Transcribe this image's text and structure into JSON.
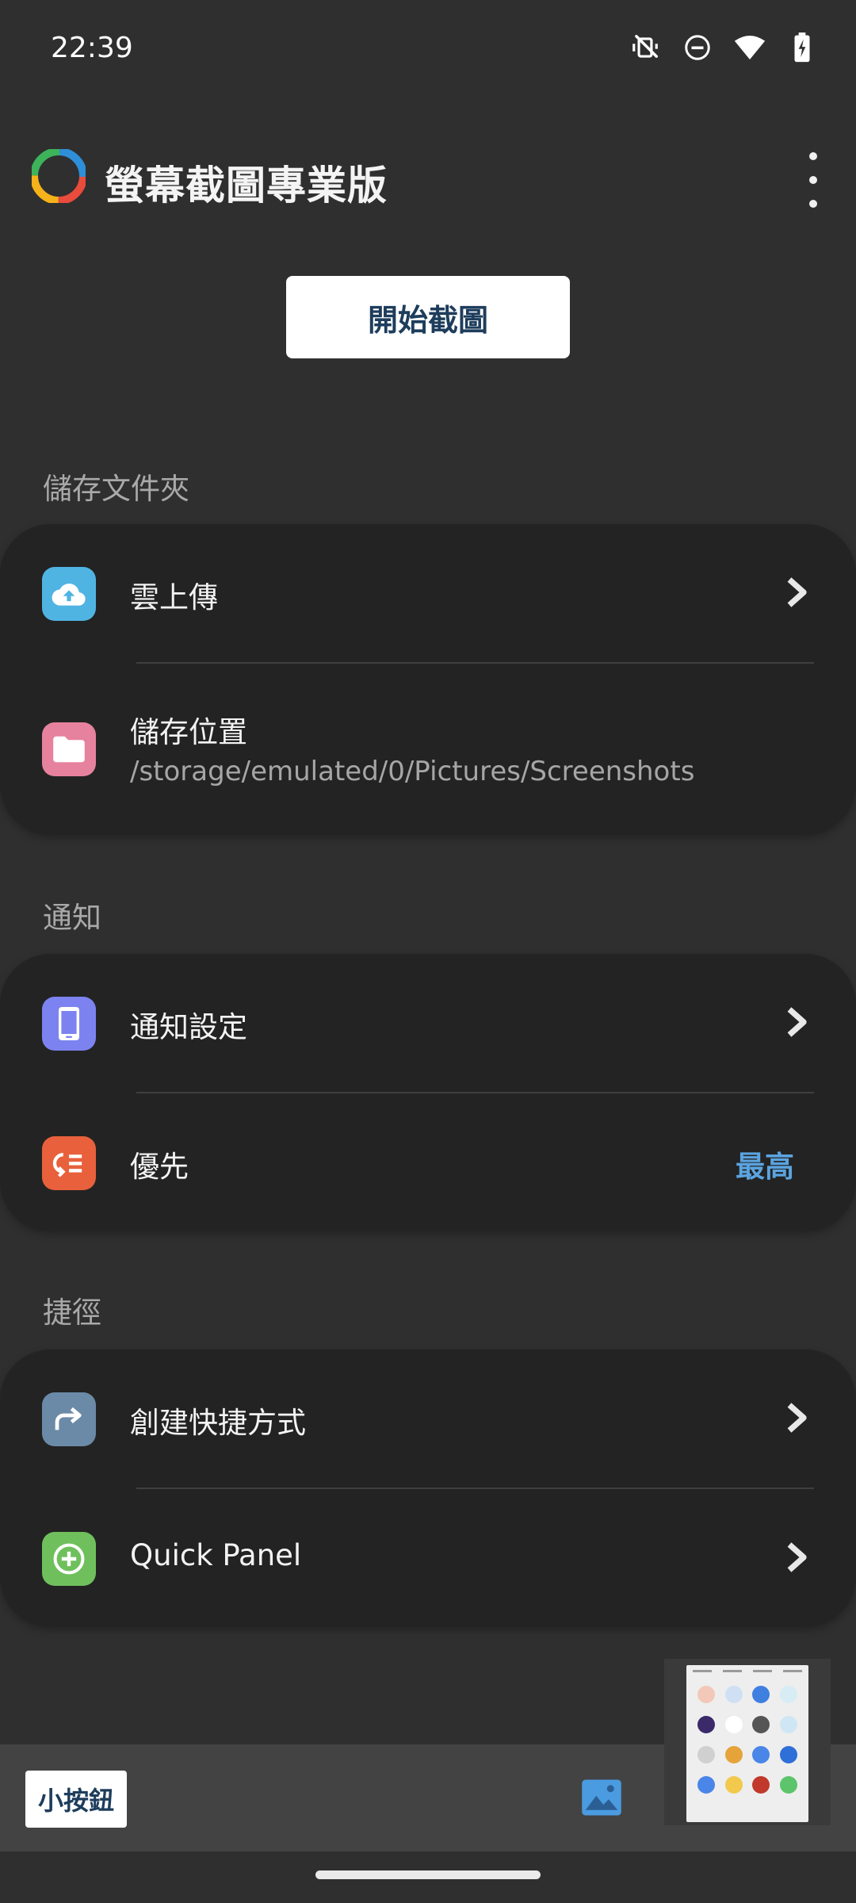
{
  "status_bar": {
    "time": "22:39",
    "icons": [
      "vibrate-off-icon",
      "do-not-disturb-icon",
      "wifi-icon",
      "battery-charging-icon"
    ]
  },
  "app_bar": {
    "title": "螢幕截圖專業版",
    "menu_icon": "more-vert-icon"
  },
  "start_button": {
    "label": "開始截圖"
  },
  "sections": {
    "storage": {
      "label": "儲存文件夾",
      "items": [
        {
          "title": "雲上傳",
          "icon": "cloud-upload-icon",
          "icon_color": "#4fb4e2"
        },
        {
          "title": "儲存位置",
          "subtitle": "/storage/emulated/0/Pictures/Screenshots",
          "icon": "folder-icon",
          "icon_color": "#e7829e"
        }
      ]
    },
    "notification": {
      "label": "通知",
      "items": [
        {
          "title": "通知設定",
          "icon": "phone-icon",
          "icon_color": "#7c83f0"
        },
        {
          "title": "優先",
          "value": "最高",
          "icon": "priority-icon",
          "icon_color": "#e8603c"
        }
      ]
    },
    "shortcut": {
      "label": "捷徑",
      "items": [
        {
          "title": "創建快捷方式",
          "icon": "share-arrow-icon",
          "icon_color": "#6b8aa8"
        },
        {
          "title": "Quick Panel",
          "icon": "add-circle-icon",
          "icon_color": "#6fc05c"
        }
      ]
    }
  },
  "bottom_bar": {
    "small_button_label": "小按鈕",
    "gallery_icon": "image-icon"
  },
  "colors": {
    "background": "#2f2f2f",
    "card": "#232323",
    "accent_value": "#5ba4e0",
    "button_text": "#1e3d5c"
  }
}
